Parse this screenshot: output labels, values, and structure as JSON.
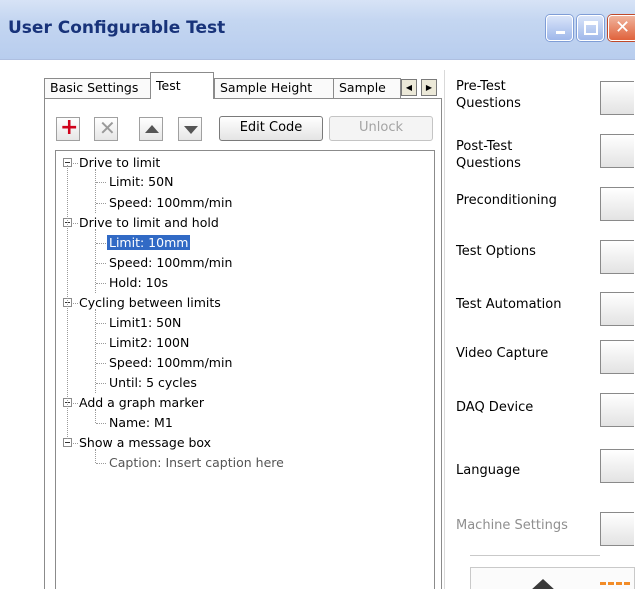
{
  "window": {
    "title": "User Configurable Test",
    "controls": {
      "minimize": "minimize-icon",
      "maximize": "maximize-icon",
      "close": "close-icon"
    }
  },
  "tabs": [
    {
      "label": "Basic Settings",
      "active": false
    },
    {
      "label": "Test",
      "active": true
    },
    {
      "label": "Sample Height",
      "active": false
    },
    {
      "label": "Sample",
      "active": false
    }
  ],
  "toolbar": {
    "add_icon": "plus-icon",
    "delete_icon": "x-icon",
    "up_icon": "move-up-icon",
    "down_icon": "move-down-icon",
    "edit_code_label": "Edit Code",
    "unlock_label": "Unlock"
  },
  "tree": [
    {
      "label": "Drive to limit",
      "children": [
        "Limit: 50N",
        "Speed: 100mm/min"
      ]
    },
    {
      "label": "Drive to limit and hold",
      "children": [
        "Limit: 10mm",
        "Speed: 100mm/min",
        "Hold: 10s"
      ],
      "selected_child": 0
    },
    {
      "label": "Cycling between limits",
      "children": [
        "Limit1: 50N",
        "Limit2: 100N",
        "Speed: 100mm/min",
        "Until: 5 cycles"
      ]
    },
    {
      "label": "Add a graph marker",
      "children": [
        "Name: M1"
      ]
    },
    {
      "label": "Show a message box",
      "children": [
        "Caption: Insert caption here"
      ]
    }
  ],
  "right_panel": {
    "pre_test": {
      "line1": "Pre-Test",
      "line2": "Questions"
    },
    "post_test": {
      "line1": "Post-Test",
      "line2": "Questions"
    },
    "preconditioning": "Preconditioning",
    "test_options": "Test Options",
    "test_automation": "Test Automation",
    "video_capture": "Video Capture",
    "daq_device": "DAQ Device",
    "language": "Language",
    "machine_settings": "Machine Settings"
  },
  "colors": {
    "title_text": "#18337a",
    "selection": "#316ac5",
    "add_icon": "#d0021b"
  }
}
